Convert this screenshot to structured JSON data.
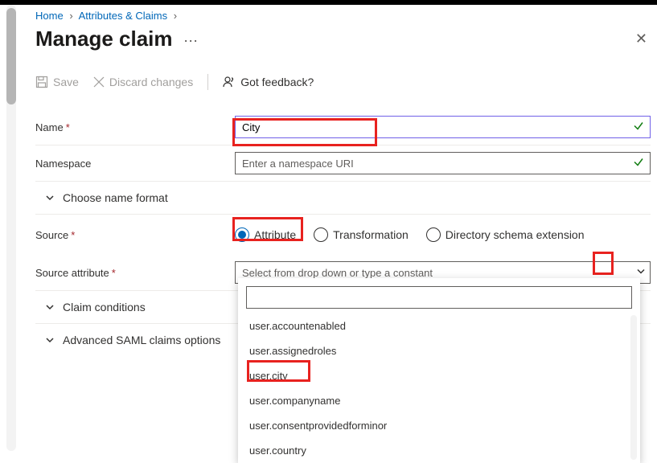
{
  "breadcrumb": {
    "home": "Home",
    "attr": "Attributes & Claims"
  },
  "title": "Manage claim",
  "toolbar": {
    "save": "Save",
    "discard": "Discard changes",
    "feedback": "Got feedback?"
  },
  "labels": {
    "name": "Name",
    "namespace": "Namespace",
    "choose_format": "Choose name format",
    "source": "Source",
    "source_attr": "Source attribute",
    "claim_conditions": "Claim conditions",
    "advanced": "Advanced SAML claims options"
  },
  "fields": {
    "name_value": "City",
    "namespace_placeholder": "Enter a namespace URI",
    "source_attr_placeholder": "Select from drop down or type a constant"
  },
  "source_options": {
    "attribute": "Attribute",
    "transformation": "Transformation",
    "directory": "Directory schema extension"
  },
  "dropdown": {
    "items": [
      "user.accountenabled",
      "user.assignedroles",
      "user.city",
      "user.companyname",
      "user.consentprovidedforminor",
      "user.country"
    ]
  }
}
